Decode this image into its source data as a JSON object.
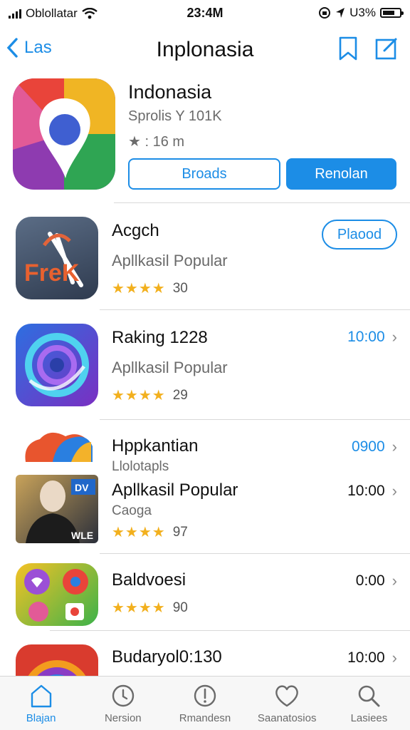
{
  "status": {
    "carrier": "Oblollatar",
    "time": "23:4M",
    "battery": "U3%"
  },
  "nav": {
    "back_label": "Las",
    "title": "Inplonasia"
  },
  "featured": {
    "title": "Indonasia",
    "subtitle": "Sprolis Y 101K",
    "rating": "★ : 16 m",
    "outline_button": "Broads",
    "fill_button": "Renolan"
  },
  "list": [
    {
      "name": "Acgch",
      "category": "Apllkasil Popular",
      "stars": "★★★★",
      "rating_count": "30",
      "action": "Plaood"
    },
    {
      "name": "Raking 1228",
      "category": "Apllkasil Popular",
      "stars": "★★★★",
      "rating_count": "29",
      "time": "10:00"
    },
    {
      "name": "Hppkantian",
      "sub": "Llolotapls",
      "time": "0900"
    },
    {
      "name": "Apllkasil Popular",
      "sub": "Caoga",
      "stars": "★★★★",
      "rating_count": "97",
      "time": "10:00"
    },
    {
      "name": "Baldvoesi",
      "stars": "★★★★",
      "rating_count": "90",
      "time": "0:00"
    },
    {
      "name": "Budaryol0:130",
      "time": "10:00"
    }
  ],
  "icon_texts": {
    "fire": "FreK",
    "app4_corner": "DV",
    "app4_badge": "WLE"
  },
  "tabs": [
    {
      "label": "Blajan",
      "icon": "home-icon",
      "active": true
    },
    {
      "label": "Nersion",
      "icon": "clock-icon",
      "active": false
    },
    {
      "label": "Rmandesn",
      "icon": "info-icon",
      "active": false
    },
    {
      "label": "Saanatosios",
      "icon": "heart-icon",
      "active": false
    },
    {
      "label": "Lasiees",
      "icon": "search-icon",
      "active": false
    }
  ],
  "colors": {
    "accent": "#1c8de6",
    "star": "#f2b01e"
  }
}
